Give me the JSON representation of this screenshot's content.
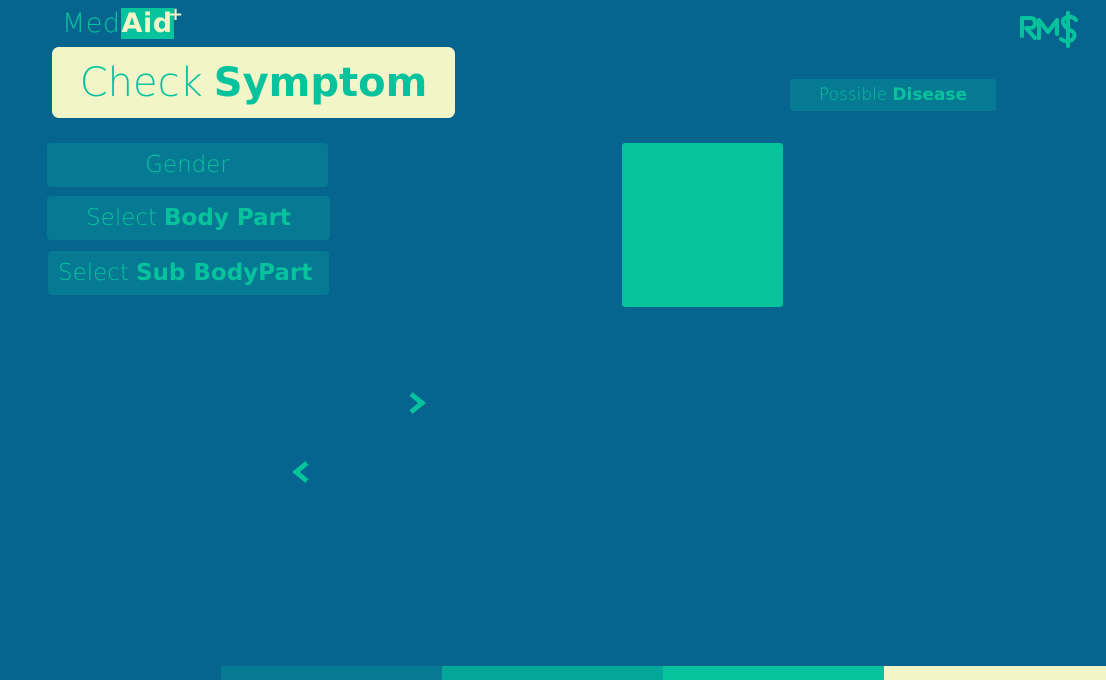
{
  "app": {
    "logo_part1": "Med",
    "logo_part2": "Aid",
    "logo_plus": "+",
    "brand_icon": "rms-logo-icon"
  },
  "header": {
    "title_light": "Check",
    "title_bold": "Symptom"
  },
  "form": {
    "gender_label": "Gender",
    "body_part_light": "Select",
    "body_part_bold": "Body Part",
    "sub_body_part_light": "Select",
    "sub_body_part_bold": "Sub BodyPart"
  },
  "results": {
    "disease_light": "Possible",
    "disease_bold": "Disease"
  },
  "navigation": {
    "next_icon": "chevron-right-icon",
    "prev_icon": "chevron-left-icon"
  },
  "colors": {
    "background": "#05658e",
    "accent": "#07c39d",
    "cream": "#f2f5c8",
    "field_bg": "#067a92",
    "bar_segments": [
      "#05658e",
      "#067a92",
      "#05a69a",
      "#07c39d",
      "#f2f5c8"
    ]
  }
}
